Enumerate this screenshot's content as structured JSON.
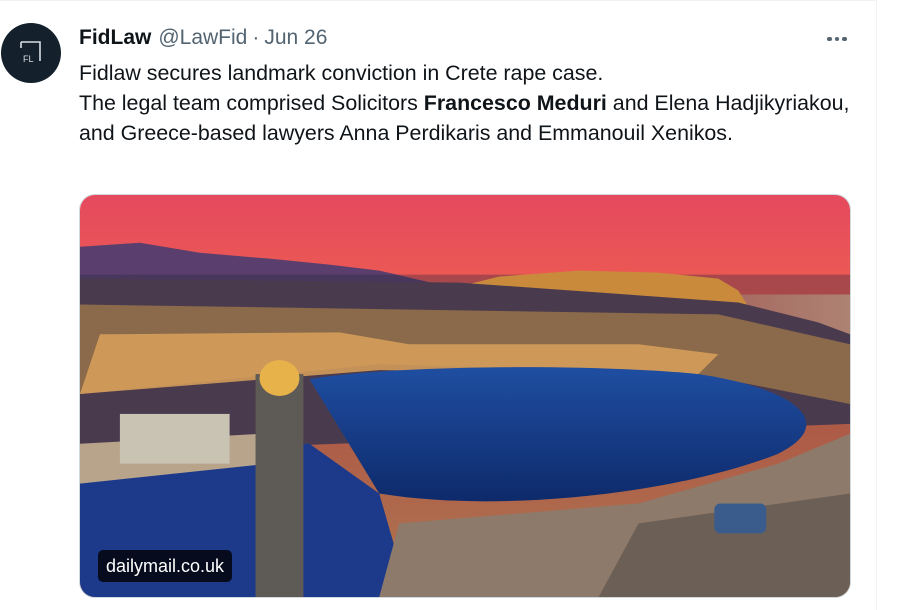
{
  "tweet": {
    "author": {
      "name": "FidLaw",
      "handle": "@LawFid",
      "avatar_initials": "FL"
    },
    "separator": "·",
    "date": "Jun 26",
    "body": {
      "line1": "Fidlaw secures landmark conviction in Crete rape case.",
      "line2_prefix": "The legal team comprised Solicitors ",
      "bold_name": "Francesco Meduri",
      "line2_suffix": " and Elena Hadjikyriakou, and Greece-based lawyers Anna Perdikaris and Emmanouil Xenikos."
    },
    "media": {
      "source_label": "dailymail.co.uk",
      "description_icon": "harbour-photo"
    }
  },
  "icons": {
    "more": "more-horizontal-icon"
  },
  "colors": {
    "text": "#0f1419",
    "secondary": "#536471",
    "avatar_bg": "#14202b",
    "border": "#cfd9de"
  }
}
